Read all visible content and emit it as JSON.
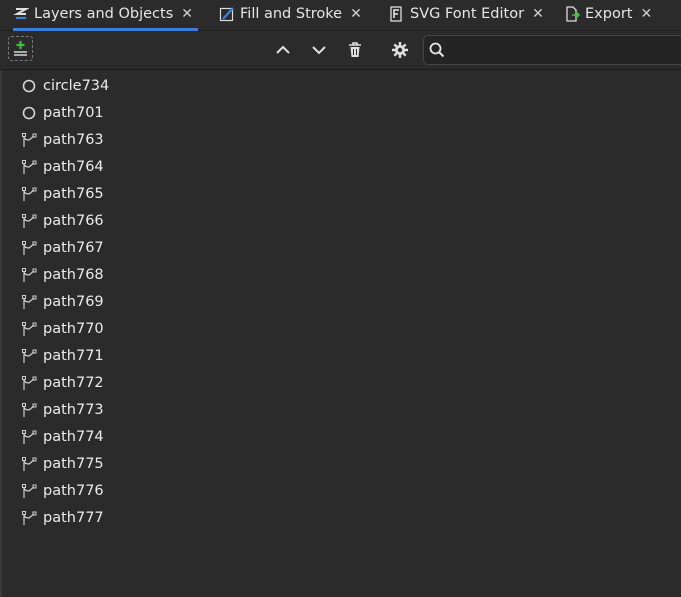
{
  "tabs": [
    {
      "label": "Layers and Objects",
      "icon": "layers-icon",
      "active": true
    },
    {
      "label": "Fill and Stroke",
      "icon": "fill-stroke-icon",
      "active": false
    },
    {
      "label": "SVG Font Editor",
      "icon": "font-editor-icon",
      "active": false
    },
    {
      "label": "Export",
      "icon": "export-icon",
      "active": false
    }
  ],
  "tab_close_glyph": "✕",
  "toolbar": {
    "add_layer": "add-layer-icon",
    "move_up": "chevron-up-icon",
    "move_down": "chevron-down-icon",
    "delete": "trash-icon",
    "settings": "gear-icon",
    "search": "search-icon"
  },
  "objects": [
    {
      "name": "circle734",
      "type": "circle"
    },
    {
      "name": "path701",
      "type": "circle"
    },
    {
      "name": "path763",
      "type": "path"
    },
    {
      "name": "path764",
      "type": "path"
    },
    {
      "name": "path765",
      "type": "path"
    },
    {
      "name": "path766",
      "type": "path"
    },
    {
      "name": "path767",
      "type": "path"
    },
    {
      "name": "path768",
      "type": "path"
    },
    {
      "name": "path769",
      "type": "path"
    },
    {
      "name": "path770",
      "type": "path"
    },
    {
      "name": "path771",
      "type": "path"
    },
    {
      "name": "path772",
      "type": "path"
    },
    {
      "name": "path773",
      "type": "path"
    },
    {
      "name": "path774",
      "type": "path"
    },
    {
      "name": "path775",
      "type": "path"
    },
    {
      "name": "path776",
      "type": "path"
    },
    {
      "name": "path777",
      "type": "path"
    }
  ],
  "colors": {
    "accent": "#3d7fd6",
    "add_green": "#3fbf3f",
    "background": "#2b2b2b"
  }
}
